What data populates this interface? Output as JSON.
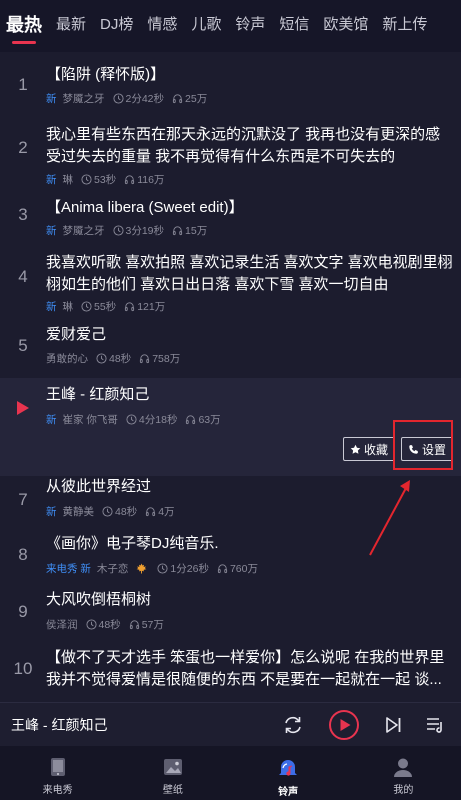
{
  "tabs": [
    "最热",
    "最新",
    "DJ榜",
    "情感",
    "儿歌",
    "铃声",
    "短信",
    "欧美馆",
    "新上传"
  ],
  "active_tab": 0,
  "songs": [
    {
      "num": "1",
      "title": "【陷阱 (释怀版)】",
      "tag": "新",
      "author": "梦魇之牙",
      "duration": "2分42秒",
      "listens": "25万"
    },
    {
      "num": "2",
      "title": "我心里有些东西在那天永远的沉默没了 我再也没有更深的感受过失去的重量 我不再觉得有什么东西是不可失去的",
      "tag": "新",
      "author": "琳",
      "duration": "53秒",
      "listens": "116万"
    },
    {
      "num": "3",
      "title": "【Anima libera (Sweet edit)】",
      "tag": "新",
      "author": "梦魇之牙",
      "duration": "3分19秒",
      "listens": "15万"
    },
    {
      "num": "4",
      "title": "我喜欢听歌 喜欢拍照 喜欢记录生活 喜欢文字 喜欢电视剧里栩栩如生的他们 喜欢日出日落 喜欢下雪 喜欢一切自由",
      "tag": "新",
      "author": "琳",
      "duration": "55秒",
      "listens": "121万"
    },
    {
      "num": "5",
      "title": "爱财爱己",
      "tag": "",
      "author": "勇敢的心",
      "duration": "48秒",
      "listens": "758万"
    },
    {
      "num": "",
      "title": "王峰 - 红颜知己",
      "tag": "新",
      "author": "崔家 你飞哥",
      "duration": "4分18秒",
      "listens": "63万",
      "playing": true
    },
    {
      "num": "7",
      "title": "从彼此世界经过",
      "tag": "新",
      "author": "黄静美",
      "duration": "48秒",
      "listens": "4万"
    },
    {
      "num": "8",
      "title": "《画你》电子琴DJ纯音乐.",
      "tag": "来电秀 新",
      "author": "木子恋",
      "duration": "1分26秒",
      "listens": "760万"
    },
    {
      "num": "9",
      "title": "大风吹倒梧桐树",
      "tag": "",
      "author": "侯泽润",
      "duration": "48秒",
      "listens": "57万"
    },
    {
      "num": "10",
      "title": "【做不了天才选手 笨蛋也一样爱你】怎么说呢 在我的世界里 我并不觉得爱情是很随便的东西 不是要在一起就在一起 谈...",
      "tag": "",
      "author": "",
      "duration": "",
      "listens": ""
    }
  ],
  "actions": {
    "favorite": "收藏",
    "set": "设置"
  },
  "player": {
    "title": "王峰 - 红颜知己"
  },
  "nav": [
    {
      "label": "来电秀",
      "icon": "phone-show-icon"
    },
    {
      "label": "壁纸",
      "icon": "wallpaper-icon"
    },
    {
      "label": "铃声",
      "icon": "ringtone-icon"
    },
    {
      "label": "我的",
      "icon": "profile-icon"
    }
  ],
  "active_nav": 2,
  "colors": {
    "accent": "#e8344f",
    "tag_blue": "#3f8ef5",
    "annotation_red": "#e3262e",
    "background": "#1c1c2e"
  }
}
